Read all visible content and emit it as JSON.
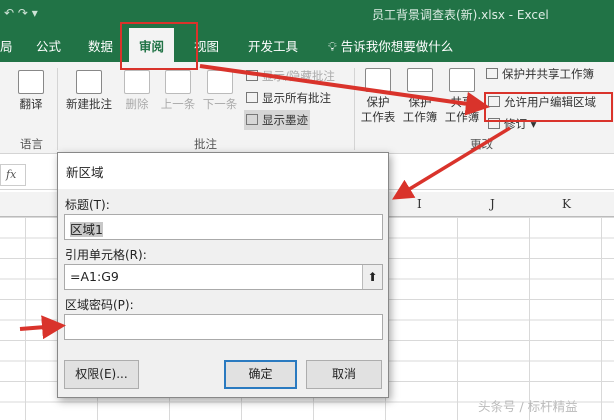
{
  "window": {
    "title": "员工背景调查表(新).xlsx  -  Excel",
    "qat": "↶ ↷ ▾"
  },
  "tabs": [
    {
      "label": "局"
    },
    {
      "label": "公式"
    },
    {
      "label": "数据"
    },
    {
      "label": "审阅",
      "active": true
    },
    {
      "label": "视图"
    },
    {
      "label": "开发工具"
    },
    {
      "label": "告诉我你想要做什么"
    }
  ],
  "ribbon": {
    "language": {
      "translate": "翻译",
      "group": "语言"
    },
    "comments": {
      "new": "新建批注",
      "delete": "删除",
      "prev": "上一条",
      "next": "下一条",
      "show_hide": "显示/隐藏批注",
      "show_all": "显示所有批注",
      "show_ink": "显示墨迹",
      "group": "批注"
    },
    "changes": {
      "protect_sheet": [
        "保护",
        "工作表"
      ],
      "protect_wb": [
        "保护",
        "工作簿"
      ],
      "share_wb": [
        "共享",
        "工作簿"
      ],
      "protect_share": "保护并共享工作簿",
      "allow_edit": "允许用户编辑区域",
      "track": "修订 ▾",
      "group": "更改"
    }
  },
  "formula_bar": {
    "fx": "fx"
  },
  "columns": [
    "I",
    "J",
    "K"
  ],
  "dialog": {
    "title": "新区域",
    "title_label": "标题(T):",
    "title_value": "区域1",
    "ref_label": "引用单元格(R):",
    "ref_value": "=A1:G9",
    "pwd_label": "区域密码(P):",
    "pwd_value": "",
    "permissions": "权限(E)...",
    "ok": "确定",
    "cancel": "取消"
  },
  "watermark": "头条号 / 标杆精益",
  "colors": {
    "excel_green": "#217346",
    "annotation_red": "#d9332b"
  }
}
